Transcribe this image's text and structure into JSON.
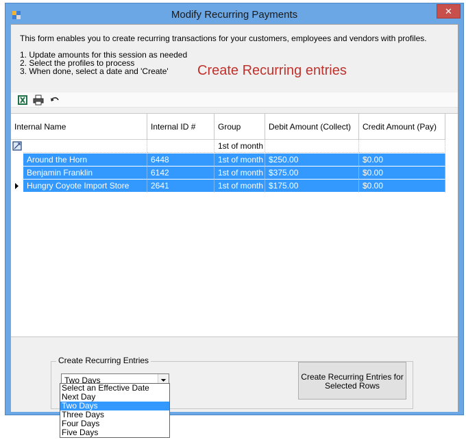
{
  "window": {
    "title": "Modify Recurring Payments",
    "close_label": "✕"
  },
  "instructions": {
    "intro": "This form enables you to create recurring transactions for your customers, employees and vendors with profiles.",
    "steps": [
      "1. Update amounts for this session as needed",
      "2. Select the profiles to process",
      "3. When done, select a date and 'Create'"
    ],
    "headline": "Create Recurring entries"
  },
  "toolbar": {
    "icons": [
      "excel-export-icon",
      "print-icon",
      "undo-icon"
    ]
  },
  "grid": {
    "columns": [
      "Internal Name",
      "Internal ID #",
      "Group",
      "Debit Amount (Collect)",
      "Credit Amount (Pay)"
    ],
    "filter_row": [
      "",
      "",
      "1st of month",
      "",
      ""
    ],
    "rows": [
      [
        "Around the Horn",
        "6448",
        "1st of month",
        "$250.00",
        "$0.00"
      ],
      [
        "Benjamin Franklin",
        "6142",
        "1st of month",
        "$375.00",
        "$0.00"
      ],
      [
        "Hungry Coyote Import Store",
        "2641",
        "1st of month",
        "$175.00",
        "$0.00"
      ]
    ],
    "current_row_index": 2
  },
  "create_group": {
    "label": "Create Recurring Entries",
    "selected_option": "Two Days",
    "options": [
      "Select an Effective Date",
      "Next Day",
      "Two Days",
      "Three Days",
      "Four Days",
      "Five Days"
    ],
    "button_label_line1": "Create Recurring Entries for",
    "button_label_line2": "Selected Rows"
  },
  "colors": {
    "selection": "#3399ff",
    "headline": "#c0312b",
    "window_frame": "#6aa7e4",
    "close_button": "#c7504c"
  }
}
